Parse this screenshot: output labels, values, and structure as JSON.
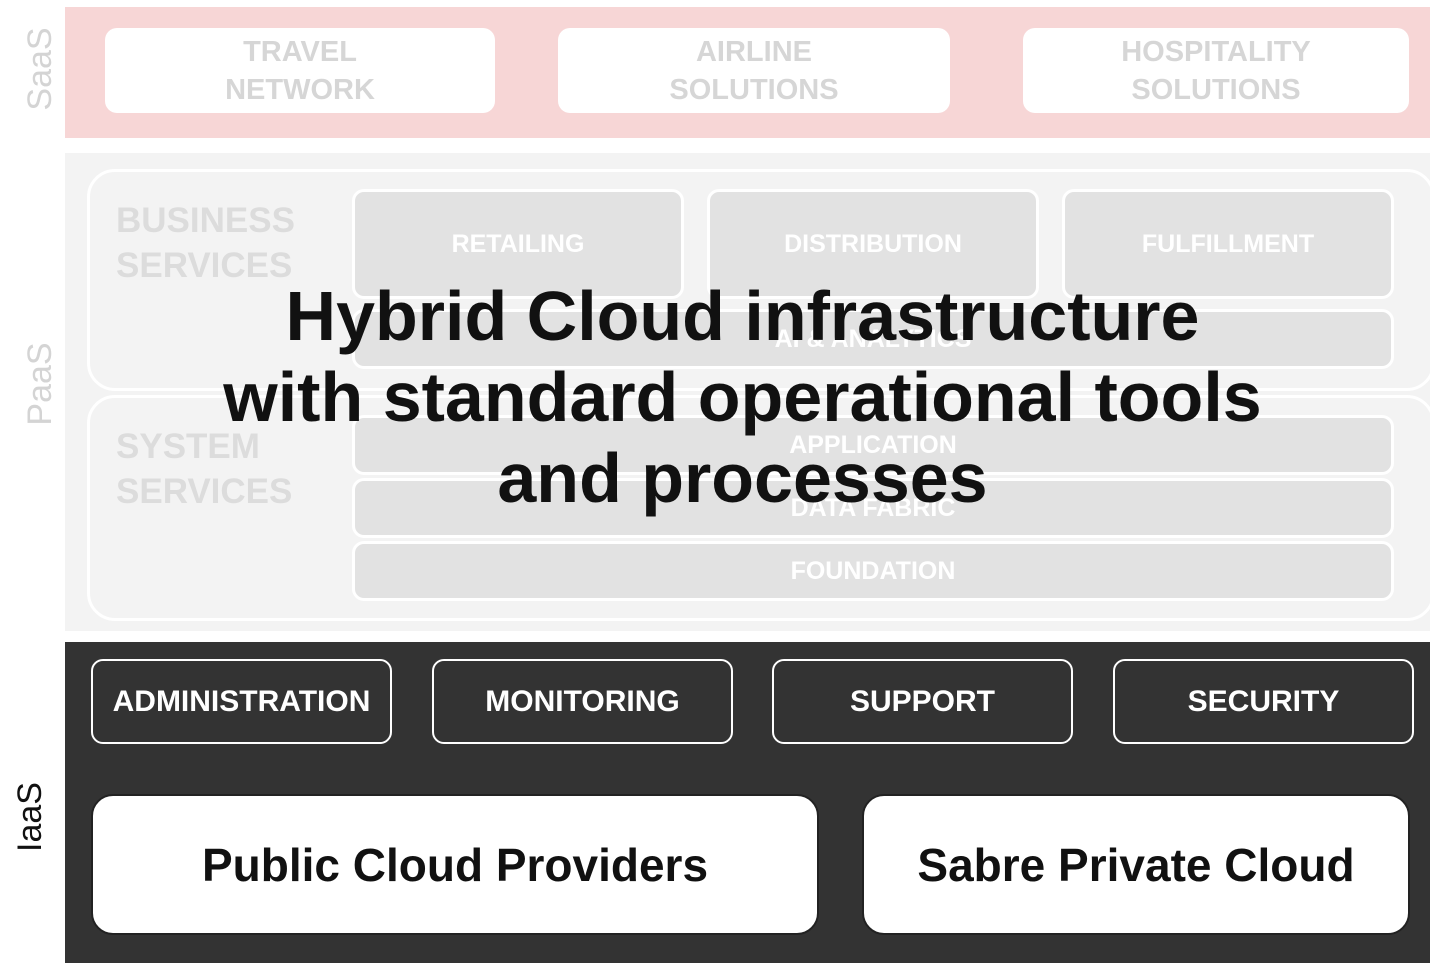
{
  "layers": {
    "saas": "SaaS",
    "paas": "PaaS",
    "iaas": "IaaS"
  },
  "saas": {
    "boxes": [
      "TRAVEL\nNETWORK",
      "AIRLINE\nSOLUTIONS",
      "HOSPITALITY\nSOLUTIONS"
    ]
  },
  "paas": {
    "business_services": {
      "label": "BUSINESS\nSERVICES",
      "boxes": [
        "RETAILING",
        "DISTRIBUTION",
        "FULFILLMENT"
      ],
      "wide": "AI & ANALYTICS"
    },
    "system_services": {
      "label": "SYSTEM\nSERVICES",
      "rows": [
        "APPLICATION",
        "DATA FABRIC",
        "FOUNDATION"
      ]
    }
  },
  "iaas": {
    "tools": [
      "ADMINISTRATION",
      "MONITORING",
      "SUPPORT",
      "SECURITY"
    ],
    "clouds": [
      "Public Cloud Providers",
      "Sabre Private Cloud"
    ]
  },
  "headline": "Hybrid Cloud infrastructure\nwith standard operational tools\nand processes",
  "colors": {
    "saas_band": "#f7d6d6",
    "paas_band": "#f3f3f3",
    "iaas_band": "#333333",
    "faded_text": "#d6d6d6",
    "headline": "#111111"
  }
}
